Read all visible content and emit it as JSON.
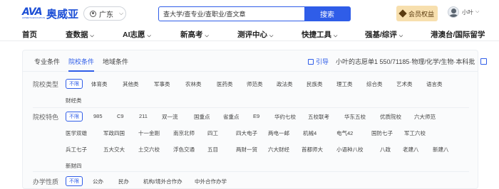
{
  "brand": {
    "name": "奥威亚",
    "mark": "AVA",
    "mark_sub": "AOWEIYA EDUCATION"
  },
  "location": {
    "label": "广东"
  },
  "search": {
    "placeholder": "查大学/查专业/查职业/查文章",
    "button": "搜索"
  },
  "vip": {
    "label": "会员权益"
  },
  "user": {
    "name": "小叶"
  },
  "nav": [
    {
      "label": "首页"
    },
    {
      "label": "查数据"
    },
    {
      "label": "AI志愿"
    },
    {
      "label": "新高考"
    },
    {
      "label": "测评中心"
    },
    {
      "label": "快捷工具"
    },
    {
      "label": "强基/综评"
    },
    {
      "label": "港澳台/国际留学"
    }
  ],
  "filter_tabs": [
    {
      "label": "专业条件",
      "active": false
    },
    {
      "label": "院校条件",
      "active": true
    },
    {
      "label": "地域条件",
      "active": false
    }
  ],
  "info": {
    "tag": "引导",
    "text": "小叶的志愿单1  550/71185·物理/化学/生物·本科批"
  },
  "school_type": {
    "label": "院校类型",
    "options": [
      "不限",
      "体育类",
      "其他类",
      "军事类",
      "农林类",
      "医药类",
      "师范类",
      "政法类",
      "民族类",
      "理工类",
      "综合类",
      "艺术类",
      "语言类",
      "财经类"
    ]
  },
  "school_feature": {
    "label": "院校特色",
    "options": [
      "不限",
      "985",
      "C9",
      "211",
      "双一流",
      "国重点",
      "省重点",
      "E9",
      "华约七校",
      "五校联考",
      "华东五校",
      "优质院校",
      "六大师范",
      "医学双雄",
      "军政四国",
      "十一金刚",
      "南京北师",
      "四工",
      "四大电子",
      "两电一邮",
      "机械4",
      "电气42",
      "国防七子",
      "军工六校",
      "兵工七子",
      "五大交大",
      "土交六校",
      "浮色交通",
      "五目",
      "两财一贸",
      "六大财经",
      "首都师大",
      "小语种八校",
      "八政",
      "老建八",
      "新建八",
      "新财四"
    ]
  },
  "school_nature": {
    "label": "办学性质",
    "options": [
      "不限",
      "公办",
      "民办",
      "机构/境外合作办",
      "中外合作办学"
    ]
  },
  "colors": {
    "accent": "#2f5de8",
    "vip_bg": "#f7dfae"
  }
}
